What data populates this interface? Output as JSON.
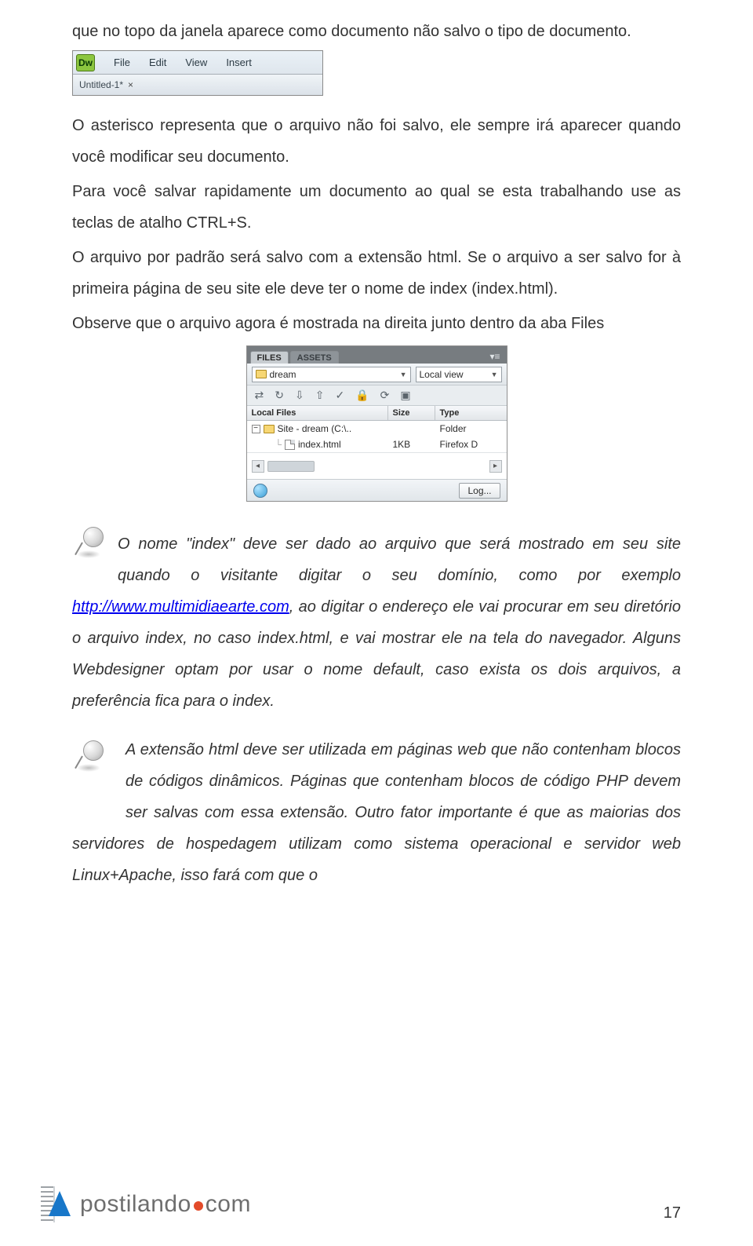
{
  "paragraphs": {
    "p1": "que no topo da janela aparece como documento não salvo o tipo de documento.",
    "p2": "O asterisco representa que o arquivo não foi salvo, ele sempre irá aparecer quando você modificar seu documento.",
    "p3a": "Para você salvar rapidamente um documento ao qual se esta trabalhando use as teclas de atalho CTRL+S.",
    "p3b": "O arquivo por padrão será salvo com a extensão html. Se o arquivo a ser salvo for à primeira página de seu site ele deve ter o nome de index (index.html).",
    "p3c": "Observe que o arquivo agora é mostrada na direita junto dentro da aba Files",
    "callout1a": "O nome \"index\" deve ser dado ao arquivo que será mostrado em seu site quando o visitante digitar o seu domínio, como por exemplo ",
    "callout1_link": "http://www.multimidiaearte.com",
    "callout1b": ", ao digitar o endereço ele vai procurar em seu diretório o arquivo index, no caso index.html, e vai mostrar ele na tela do navegador. Alguns Webdesigner optam por usar o nome default, caso exista os dois arquivos, a preferência fica para o index.",
    "callout2": "A extensão html deve ser utilizada em páginas web que não contenham blocos de códigos dinâmicos. Páginas que contenham blocos de código PHP devem ser salvas com essa extensão. Outro fator importante é que as maiorias dos servidores de hospedagem utilizam como sistema operacional e servidor web Linux+Apache, isso fará com que o"
  },
  "menubar": {
    "app_badge": "Dw",
    "items": [
      "File",
      "Edit",
      "View",
      "Insert"
    ],
    "tab_label": "Untitled-1*"
  },
  "files_panel": {
    "tab_active": "FILES",
    "tab_inactive": "ASSETS",
    "site_select": "dream",
    "view_select": "Local view",
    "columns": {
      "name": "Local Files",
      "size": "Size",
      "type": "Type"
    },
    "rows": [
      {
        "name": "Site - dream (C:\\..",
        "size": "",
        "type": "Folder",
        "icon": "folder"
      },
      {
        "name": "index.html",
        "size": "1KB",
        "type": "Firefox D",
        "icon": "file"
      }
    ],
    "log_button": "Log..."
  },
  "footer": {
    "logo_text_a": "postilando",
    "logo_text_b": "com",
    "page_number": "17"
  }
}
